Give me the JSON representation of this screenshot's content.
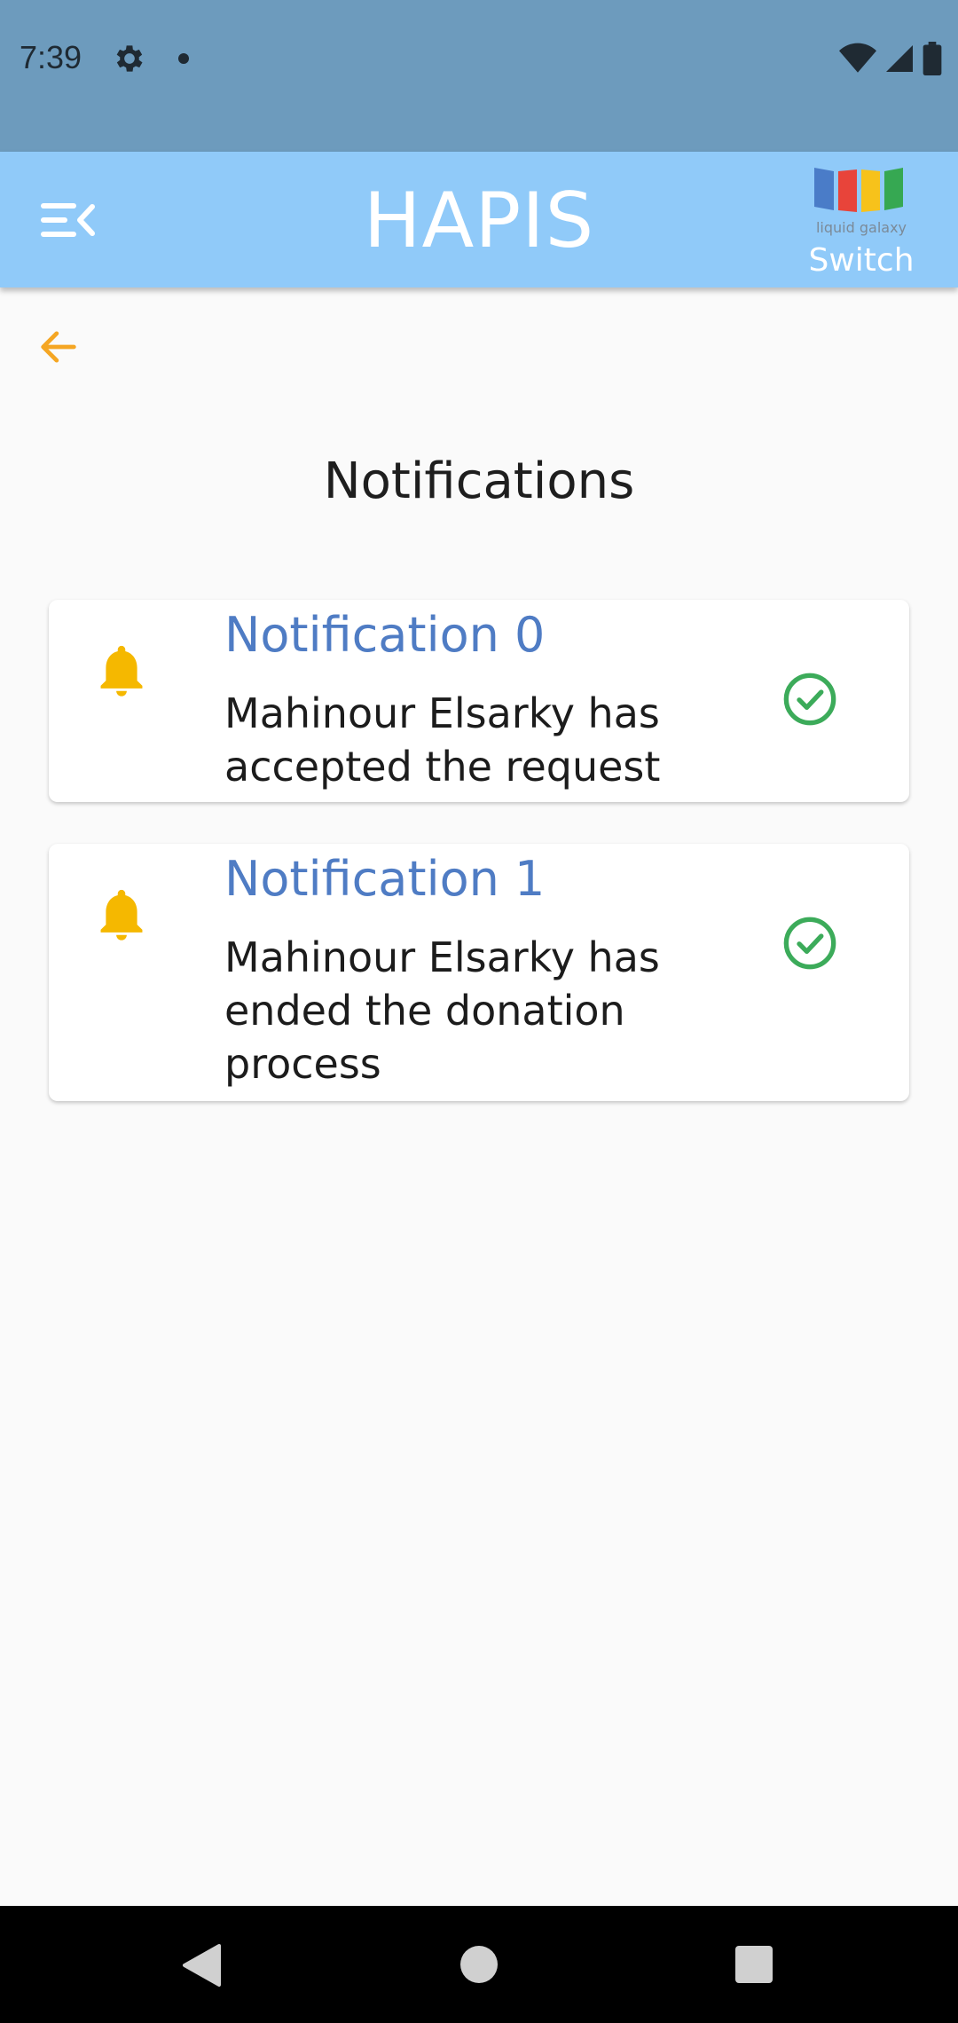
{
  "status_bar": {
    "time": "7:39"
  },
  "app_bar": {
    "title": "HAPIS",
    "logo_text": "liquid galaxy",
    "switch_label": "Switch"
  },
  "page": {
    "title": "Notifications"
  },
  "notifications": [
    {
      "title": "Notification 0",
      "body": "Mahinour Elsarky has accepted the request"
    },
    {
      "title": "Notification 1",
      "body": "Mahinour Elsarky has ended the donation process"
    }
  ],
  "colors": {
    "status_bar": "#6d9bbd",
    "app_bar": "#90caf9",
    "accent": "#f5b800",
    "title_blue": "#4f7cc4",
    "check_green": "#3cab5a"
  },
  "icons": {
    "menu": "menu-open-icon",
    "back": "arrow-back-icon",
    "bell": "bell-icon",
    "check": "check-circle-icon"
  }
}
